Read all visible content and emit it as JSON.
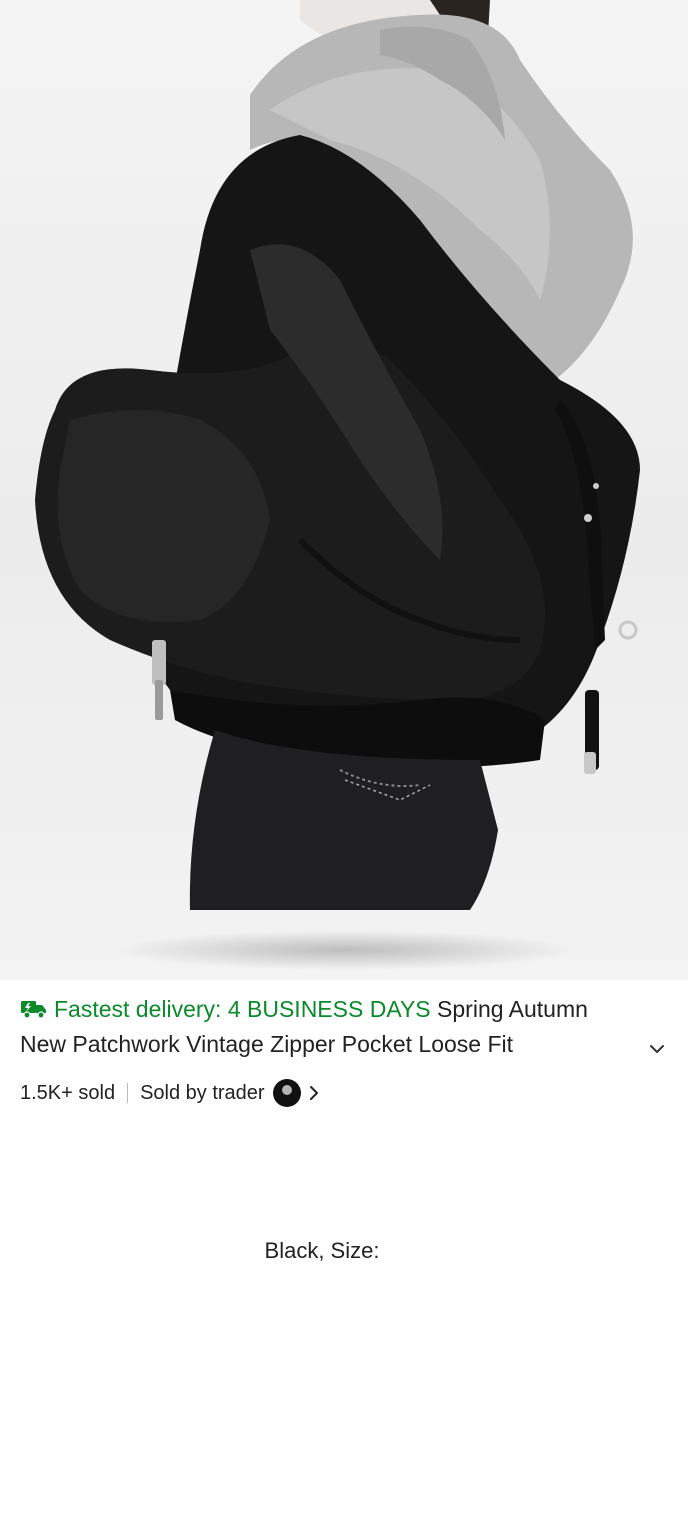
{
  "product": {
    "delivery_badge": "Fastest delivery: 4 BUSINESS DAYS",
    "title_line1": "Spring Autumn",
    "title_line2": "New Patchwork Vintage Zipper Pocket Loose Fit",
    "sold": "1.5K+ sold",
    "sold_by_label": "Sold by trader",
    "variant": "Black, Size:"
  },
  "icons": {
    "delivery": "truck-icon",
    "expand": "chevron-down-icon",
    "seller": "seller-avatar",
    "seller_link": "chevron-right-icon"
  },
  "colors": {
    "delivery_green": "#0a8a2a",
    "text": "#222222"
  }
}
